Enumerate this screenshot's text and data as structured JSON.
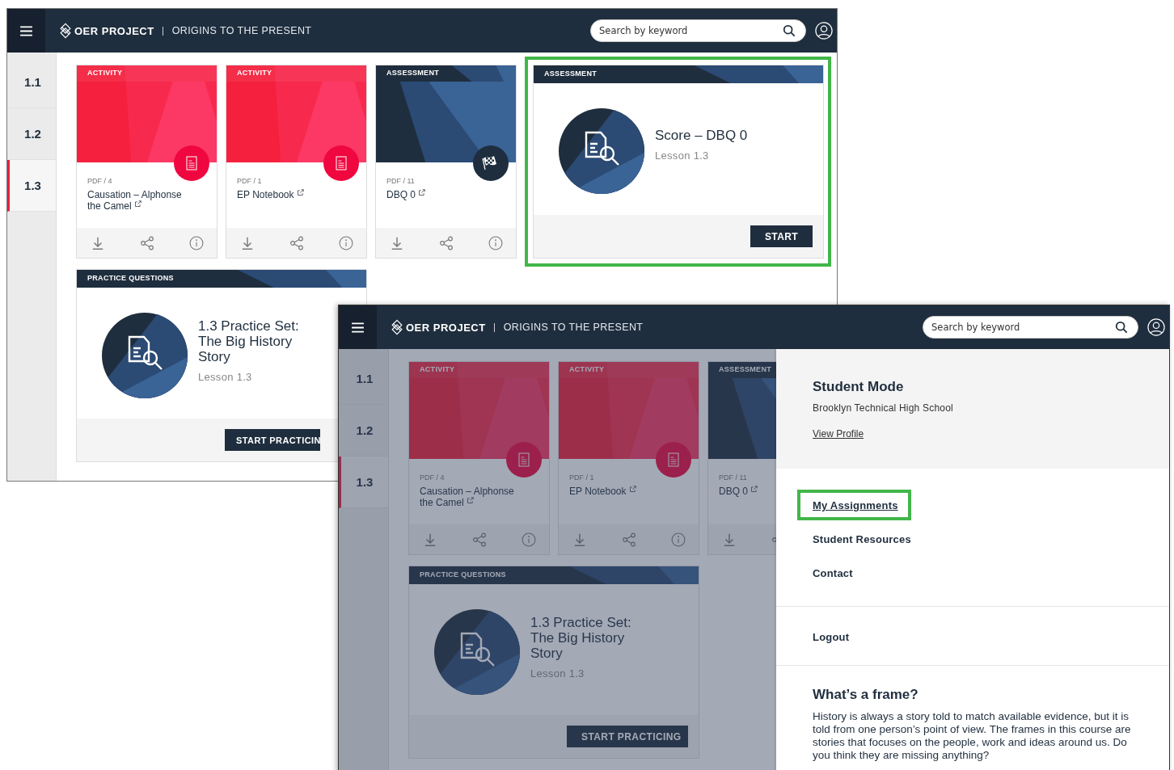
{
  "windows": [
    {
      "dimmed": false,
      "header": {
        "brand": "OER PROJECT",
        "course": "ORIGINS TO THE PRESENT",
        "search": {
          "placeholder": "Search by keyword"
        }
      },
      "lessons": [
        {
          "label": "1.1",
          "selected": false
        },
        {
          "label": "1.2",
          "selected": false
        },
        {
          "label": "1.3",
          "selected": true
        }
      ],
      "cards": [
        {
          "kind": "activity",
          "tag": "ACTIVITY",
          "meta": "PDF / 4",
          "title": "Causation – Alphonse the Camel"
        },
        {
          "kind": "activity",
          "tag": "ACTIVITY",
          "meta": "PDF / 1",
          "title": "EP Notebook"
        },
        {
          "kind": "assessment",
          "tag": "ASSESSMENT",
          "meta": "PDF / 11",
          "title": "DBQ 0"
        }
      ],
      "featured": {
        "tag": "ASSESSMENT",
        "title": "Score – DBQ 0",
        "subtitle": "Lesson 1.3",
        "button": "START",
        "highlighted": true
      },
      "practice": {
        "tag": "PRACTICE QUESTIONS",
        "title": "1.3 Practice Set: The Big History Story",
        "subtitle": "Lesson 1.3",
        "button": "START PRACTICIN"
      }
    },
    {
      "dimmed": true,
      "header": {
        "brand": "OER PROJECT",
        "course": "ORIGINS TO THE PRESENT",
        "search": {
          "placeholder": "Search by keyword"
        }
      },
      "lessons": [
        {
          "label": "1.1",
          "selected": false
        },
        {
          "label": "1.2",
          "selected": false
        },
        {
          "label": "1.3",
          "selected": true
        }
      ],
      "cards": [
        {
          "kind": "activity",
          "tag": "ACTIVITY",
          "meta": "PDF / 4",
          "title": "Causation – Alphonse the Camel"
        },
        {
          "kind": "activity",
          "tag": "ACTIVITY",
          "meta": "PDF / 1",
          "title": "EP Notebook"
        },
        {
          "kind": "assessment",
          "tag": "ASSESSMENT",
          "meta": "PDF / 11",
          "title": "DBQ 0"
        }
      ],
      "practice": {
        "tag": "PRACTICE QUESTIONS",
        "title": "1.3 Practice Set: The Big History Story",
        "subtitle": "Lesson 1.3",
        "button": "START PRACTICING"
      },
      "drawer": {
        "mode": "Student Mode",
        "school": "Brooklyn Technical High School",
        "profile_link": "View Profile",
        "menu": [
          {
            "label": "My Assignments",
            "selected": true,
            "highlighted": true
          },
          {
            "label": "Student Resources",
            "selected": false,
            "highlighted": false
          },
          {
            "label": "Contact",
            "selected": false,
            "highlighted": false
          }
        ],
        "logout": "Logout",
        "info": {
          "heading": "What’s a frame?",
          "text": "History is always a story told to match available evidence, but it is told from one person’s point of view. The frames in this course are stories that focuses on the people, work and ideas around us. Do you think they are missing anything?"
        }
      }
    }
  ]
}
